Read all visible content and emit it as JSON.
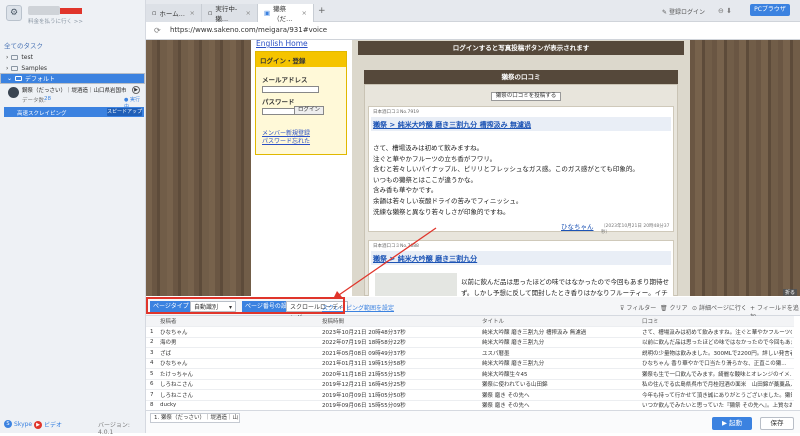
{
  "left_panel": {
    "subtitle": "料金を払うに行く >>",
    "section_title": "全てのタスク",
    "items": [
      {
        "label": "test"
      },
      {
        "label": "Samples"
      },
      {
        "label": "デフォルト"
      }
    ],
    "task": {
      "name": "鋼祭（だっさい）｜堤酒造｜山口県岩国市…",
      "data_label": "データ数:",
      "data_count": "28",
      "running": "● 実行中",
      "highlight_label": "高速スクレイピング",
      "speed_button": "スピードアップ"
    },
    "footer": {
      "skype": "Skype",
      "help": "ビデオ",
      "version": "バージョン: 4.0.1"
    }
  },
  "tabs": [
    {
      "label": "ホーム..."
    },
    {
      "label": "実行中-獺..."
    },
    {
      "label": "獺祭（だ..."
    }
  ],
  "top_right": {
    "login": "登録ログイン",
    "pc_browser": "PCブラウザ"
  },
  "url": "https://www.sakeno.com/meigara/931#voice",
  "website": {
    "home_link": "English Home",
    "login_title": "ログイン・登録",
    "email_label": "メールアドレス",
    "password_label": "パスワード",
    "login_button": "ログイン",
    "register_link": "メンバー新規登録",
    "forgot_link": "パスワード忘れた",
    "login_notice": "ログインすると写真投稿ボタンが表示されます",
    "reviews_title": "獺祭の口コミ",
    "post_button": "獺祭の口コミを投稿する",
    "review1": {
      "small": "日本酒口コミNo.7919",
      "title": "獺祭 > 純米大吟醸 磨き三割九分 槽搾汲み 無濾過",
      "lines": [
        "さて、槽場汲みは初めて飲みますね。",
        "注ぐと華やかフルーツの立ち香がフワリ。",
        "含むと若々しいパイナップル、ピリリとフレッシュなガス感。このガス感がとても印象的。",
        "いつもの獺祭とはここが違うかな。",
        "含み香も華やかです。",
        "余韻は若々しい炭酸ドライの苦みでフィニッシュ。",
        "洗練な獺祭と異なり若々しさが印象的ですね。"
      ],
      "user": "ひなちゃん",
      "date": "（2023年10月21日 20時48分37秒）"
    },
    "review2": {
      "small": "日本酒口コミNo.7688",
      "title": "獺祭 > 純米大吟醸 磨き三割九分",
      "lines": [
        "以前に飲んだ品は思ったほどの味ではなかったので今回もあまり期待せ",
        "ず。しかし予想に反して開封したとき香りはかなりフルーティー。イチ"
      ]
    },
    "expand_badge": "折る"
  },
  "toolbar": {
    "page_type_label": "ページタイプ",
    "page_type_value": "自動識別",
    "page_no_label": "ページ番号の設定",
    "page_no_value": "スクロールローディング",
    "scroll_link": "スクレイピング範囲を設定",
    "filter": "フィルター",
    "clear": "クリア",
    "detail": "詳細ページに行く",
    "add_field": "フィールドを追加"
  },
  "table": {
    "columns": [
      "",
      "投稿者",
      "投稿時間",
      "タイトル",
      "口コミ"
    ],
    "rows": [
      [
        "1",
        "ひなちゃん",
        "2023年10月21日 20時48分37秒",
        "純米大吟醸 磨き三割九分 槽搾汲み 無濾過",
        "さて、槽場汲みは初めて飲みますね。注ぐと華やかフルーツの立ち..."
      ],
      [
        "2",
        "海の男",
        "2022年07月19日 18時58分22秒",
        "純米大吟醸 磨き三割九分",
        "以前に飲んだ品は思ったほどの味ではなかったので今回もあまり期..."
      ],
      [
        "3",
        "ざば",
        "2021年05月08日 09時49分37秒",
        "ユスパ暦墨",
        "説明の少量物は飲みました。300MLで2200円。詳しい発言者は実..."
      ],
      [
        "4",
        "ひなちゃん",
        "2021年01月31日 19時15分58秒",
        "純米大吟醸 磨き三割九分",
        "ひなちゃん 香り華やかで口当たり滑らかな、正直この獺..."
      ],
      [
        "5",
        "たけっちゃん",
        "2020年11月18日 21時55分15秒",
        "純米大吟醸生々45",
        "獺祭も生で一口飲んでみます。綺麗な酸味とオレンジのイメ..."
      ],
      [
        "6",
        "しろねこさん",
        "2019年12月21日 16時45分25秒",
        "獺祭に使われている山田錦",
        "私の住んでる広島県呉市で月桂冠酒の面米　山田錦が藁藁品入手..."
      ],
      [
        "7",
        "しろねこさん",
        "2019年10月09日 11時05分50秒",
        "獺祭 磨き その先へ",
        "今年も持って行かせて頂き誠にありがとうございました。獺祭の..."
      ],
      [
        "8",
        "ducky",
        "2019年09月06日 15時55分09秒",
        "獺祭 磨き その先へ",
        "いつか飲んでみたいと思っていた『獺祭 その先へ』。上質なお酒..."
      ]
    ]
  },
  "bottom": {
    "task_tab": "1. 獺祭（だっさい）｜堤酒造｜山",
    "start_button": "▶ 起動",
    "save_button": "保存"
  }
}
